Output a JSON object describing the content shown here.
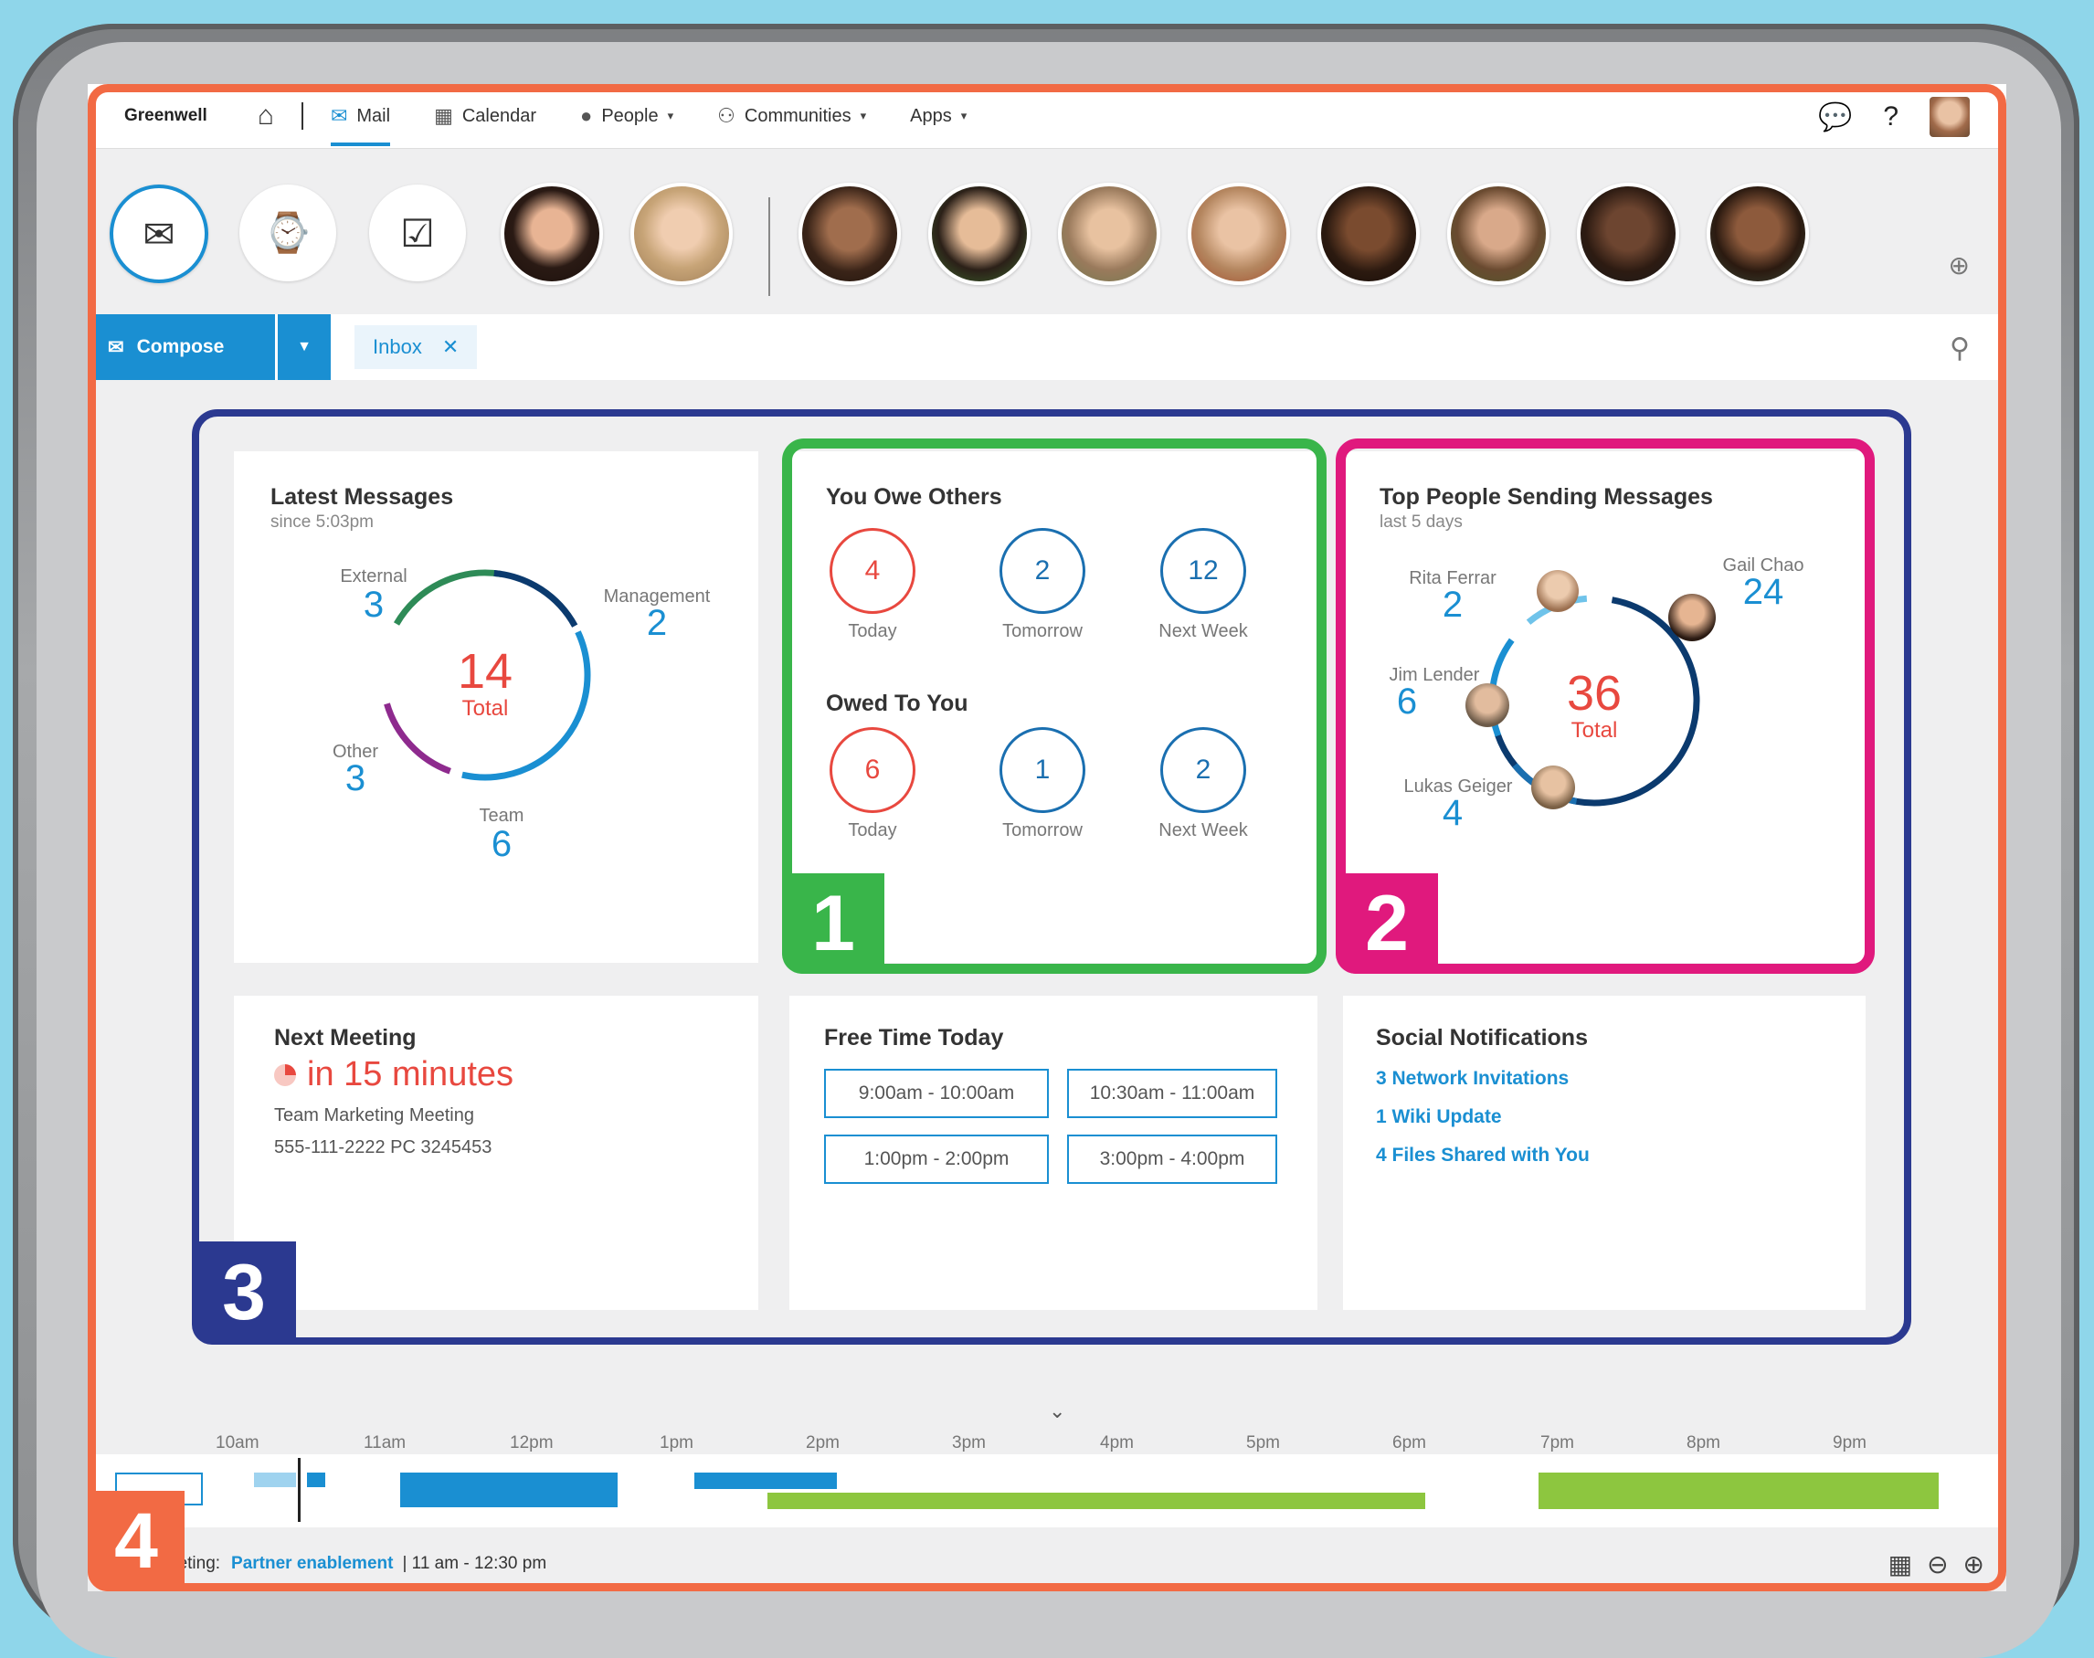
{
  "nav": {
    "brand": "Greenwell",
    "items": [
      {
        "label": "Mail"
      },
      {
        "label": "Calendar"
      },
      {
        "label": "People"
      },
      {
        "label": "Communities"
      },
      {
        "label": "Apps"
      }
    ],
    "help": "?"
  },
  "compose": {
    "button_label": "Compose",
    "tab_label": "Inbox"
  },
  "latest_messages": {
    "title": "Latest Messages",
    "subtitle": "since 5:03pm",
    "total": "14",
    "total_label": "Total",
    "segments": [
      {
        "label": "External",
        "value": "3",
        "color": "#2e8b57"
      },
      {
        "label": "Management",
        "value": "2",
        "color": "#0b3a6e"
      },
      {
        "label": "Team",
        "value": "6",
        "color": "#1a8fd2"
      },
      {
        "label": "Other",
        "value": "3",
        "color": "#8e2a8e"
      }
    ]
  },
  "you_owe_others": {
    "title": "You Owe Others",
    "items": [
      {
        "value": "4",
        "label": "Today",
        "color": "#e8483f"
      },
      {
        "value": "2",
        "label": "Tomorrow",
        "color": "#1a6fb0"
      },
      {
        "value": "12",
        "label": "Next Week",
        "color": "#1a6fb0"
      }
    ]
  },
  "owed_to_you": {
    "title": "Owed To You",
    "items": [
      {
        "value": "6",
        "label": "Today",
        "color": "#e8483f"
      },
      {
        "value": "1",
        "label": "Tomorrow",
        "color": "#1a6fb0"
      },
      {
        "value": "2",
        "label": "Next Week",
        "color": "#1a6fb0"
      }
    ]
  },
  "top_people": {
    "title": "Top People Sending Messages",
    "subtitle": "last 5 days",
    "total": "36",
    "total_label": "Total",
    "people": [
      {
        "name": "Rita Ferrar",
        "value": "2"
      },
      {
        "name": "Gail Chao",
        "value": "24"
      },
      {
        "name": "Jim Lender",
        "value": "6"
      },
      {
        "name": "Lukas Geiger",
        "value": "4"
      }
    ]
  },
  "next_meeting": {
    "title": "Next Meeting",
    "when": "in 15 minutes",
    "name": "Team Marketing Meeting",
    "phone": "555-111-2222 PC 3245453"
  },
  "free_time": {
    "title": "Free Time Today",
    "slots": [
      "9:00am - 10:00am",
      "10:30am - 11:00am",
      "1:00pm - 2:00pm",
      "3:00pm - 4:00pm"
    ]
  },
  "social": {
    "title": "Social Notifications",
    "links": [
      "3 Network Invitations",
      "1 Wiki Update",
      "4 Files Shared with You"
    ]
  },
  "timeline": {
    "hours": [
      "10am",
      "11am",
      "12pm",
      "1pm",
      "2pm",
      "3pm",
      "4pm",
      "5pm",
      "6pm",
      "7pm",
      "8pm",
      "9pm"
    ]
  },
  "footer": {
    "prefix": "eeting:",
    "meeting_link": "Partner enablement",
    "time": "| 11 am - 12:30 pm"
  },
  "callouts": {
    "one": "1",
    "two": "2",
    "three": "3",
    "four": "4"
  },
  "colors": {
    "accent": "#1a8fd2",
    "callout_orange": "#f26a44",
    "callout_green": "#39b54a",
    "callout_pink": "#e0197d",
    "callout_navy": "#2b3990",
    "timeline_green": "#8dc63f"
  }
}
